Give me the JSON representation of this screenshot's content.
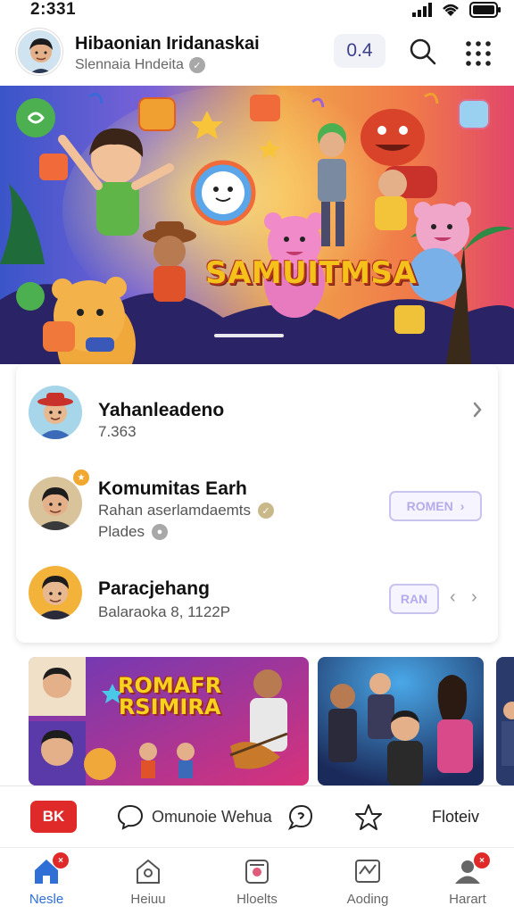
{
  "status_bar": {
    "time": "2:331"
  },
  "header": {
    "title": "Hibaonian Iridanaskai",
    "subtitle": "Slennaia Hndeita",
    "count": "0.4"
  },
  "banner": {
    "title": "SAMUITMSA"
  },
  "list": {
    "items": [
      {
        "title": "Yahanleadeno",
        "subtitle": "7.363",
        "action": "chevron"
      },
      {
        "title": "Komumitas Earh",
        "subtitle": "Rahan aserlamdaemts",
        "extra": "Plades",
        "button_label": "ROMEN"
      },
      {
        "title": "Paracjehang",
        "subtitle": "Balaraoka 8, 1122P",
        "button_label": "RAN"
      }
    ]
  },
  "thumbnails": {
    "first_title_line1": "ROMAFR",
    "first_title_line2": "RSIMIRA"
  },
  "action_bar": {
    "red_label": "BK",
    "comment_label": "Omunoie Wehua",
    "follow_label": "Floteiv"
  },
  "bottom_nav": {
    "items": [
      {
        "label": "Nesle",
        "badge": "×",
        "active": true
      },
      {
        "label": "Heiuu"
      },
      {
        "label": "Hloelts"
      },
      {
        "label": "Aoding"
      },
      {
        "label": "Harart",
        "badge": "×"
      }
    ]
  },
  "colors": {
    "accent_blue": "#2f6fd6",
    "badge_red": "#e02a2a",
    "count_text": "#3b3f8c",
    "pill_border": "#c9c4ef"
  }
}
